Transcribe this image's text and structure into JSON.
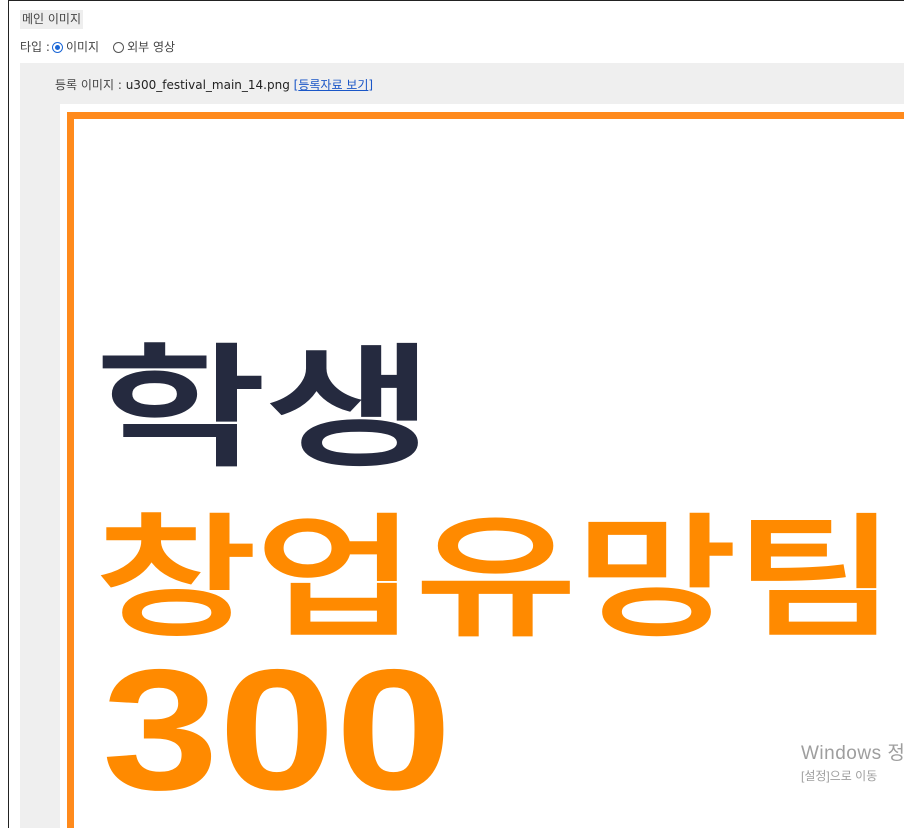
{
  "section_title": "메인 이미지",
  "type_row": {
    "label": "타입 :",
    "options": [
      {
        "label": "이미지",
        "checked": true
      },
      {
        "label": "외부 영상",
        "checked": false
      }
    ]
  },
  "registered": {
    "label": "등록 이미지 :",
    "filename": "u300_festival_main_14.png",
    "bracket_open": "[",
    "link": "등록자료 보기",
    "bracket_close": "]"
  },
  "poster": {
    "line1": "학생",
    "line2": "창업유망팀",
    "line3": "300",
    "colors": {
      "orange": "#ff8a00",
      "navy": "#252a3f",
      "border": "#ff8a1c"
    }
  },
  "watermark": {
    "line1": "Windows 정",
    "line2": "[설정]으로 이동"
  }
}
